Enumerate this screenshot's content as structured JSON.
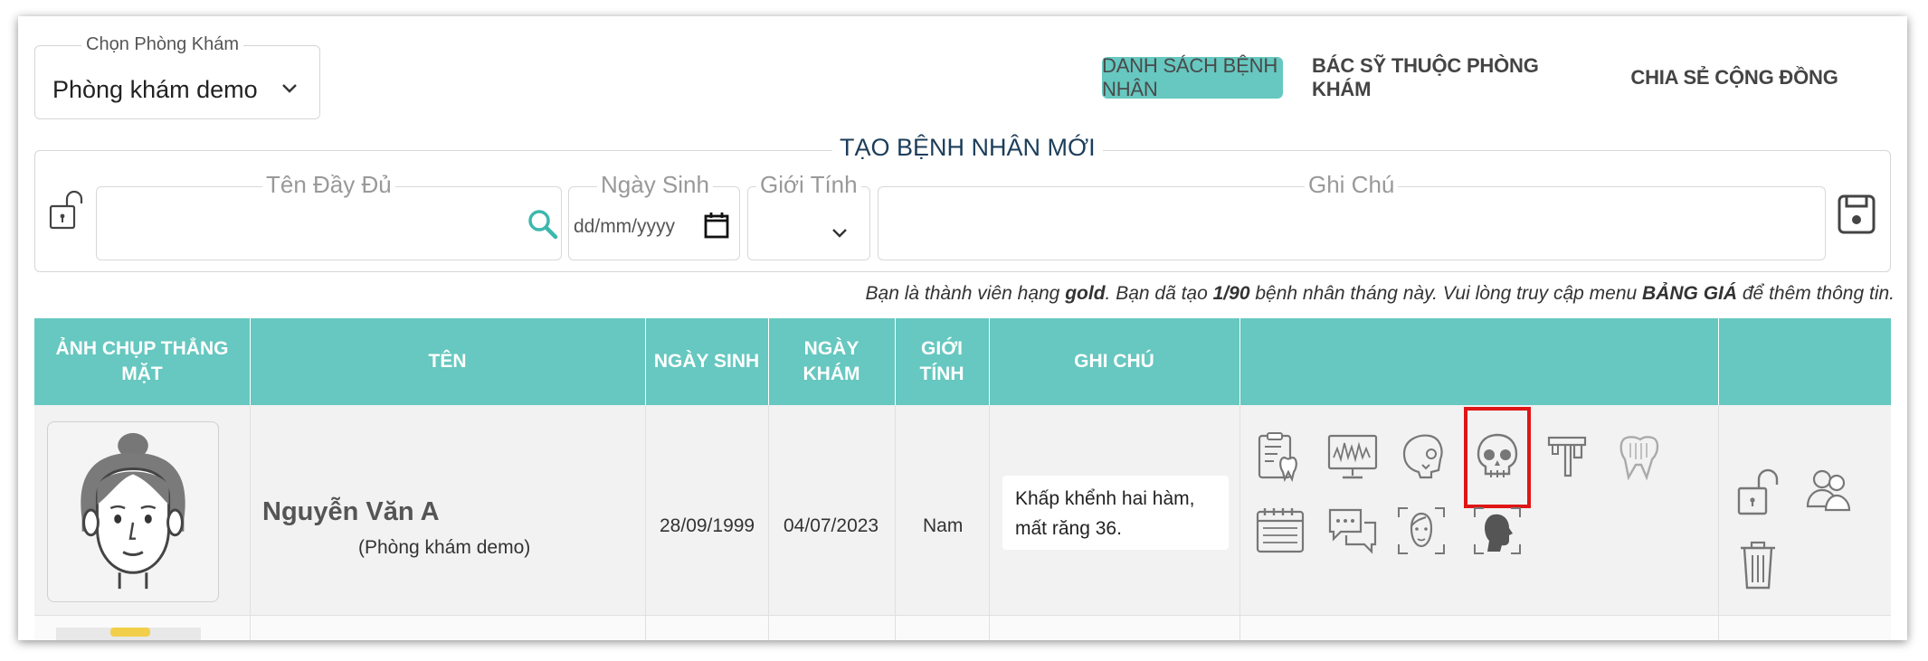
{
  "clinic_select": {
    "legend": "Chọn Phòng Khám",
    "value": "Phòng khám demo"
  },
  "tabs": [
    {
      "label": "DANH SÁCH BỆNH NHÂN",
      "active": true
    },
    {
      "label": "BÁC SỸ THUỘC PHÒNG KHÁM",
      "active": false
    },
    {
      "label": "CHIA SẺ CỘNG ĐỒNG",
      "active": false
    }
  ],
  "new_patient_form": {
    "title": "TẠO BỆNH NHÂN MỚI",
    "full_name_legend": "Tên Đầy Đủ",
    "birth_legend": "Ngày Sinh",
    "birth_placeholder": "dd/mm/yyyy",
    "gender_legend": "Giới Tính",
    "note_legend": "Ghi Chú"
  },
  "membership_info": {
    "part1": "Bạn là thành viên hạng ",
    "tier": "gold",
    "part2": ".  Bạn dã tạo ",
    "count": "1/90",
    "part3": " bệnh nhân tháng này.  Vui lòng truy cập menu ",
    "menu": "BẢNG GIÁ",
    "part4": " để thêm thông tin."
  },
  "table": {
    "headers": {
      "photo": "ẢNH CHỤP THẲNG MẶT",
      "name": "TÊN",
      "birth": "NGÀY SINH",
      "visit": "NGÀY KHÁM",
      "gender": "GIỚI TÍNH",
      "note": "GHI CHÚ"
    },
    "rows": [
      {
        "name": "Nguyễn Văn A",
        "clinic": "(Phòng khám demo)",
        "birth": "28/09/1999",
        "visit": "04/07/2023",
        "gender": "Nam",
        "note": "Khấp khểnh hai hàm, mất răng 36."
      }
    ]
  },
  "colors": {
    "accent": "#66c8c0",
    "highlight": "#e01515",
    "title": "#1c3d5a"
  },
  "icons": [
    "lock-open-icon",
    "search-icon",
    "calendar-icon",
    "chevron-down-icon",
    "save-icon",
    "dental-chart-icon",
    "monitor-scan-icon",
    "skull-side-icon",
    "skull-front-icon",
    "caliper-icon",
    "tooth-icon",
    "schedule-icon",
    "chat-icon",
    "face-front-scan-icon",
    "face-side-scan-icon",
    "unlock-patient-icon",
    "share-users-icon",
    "trash-icon"
  ]
}
